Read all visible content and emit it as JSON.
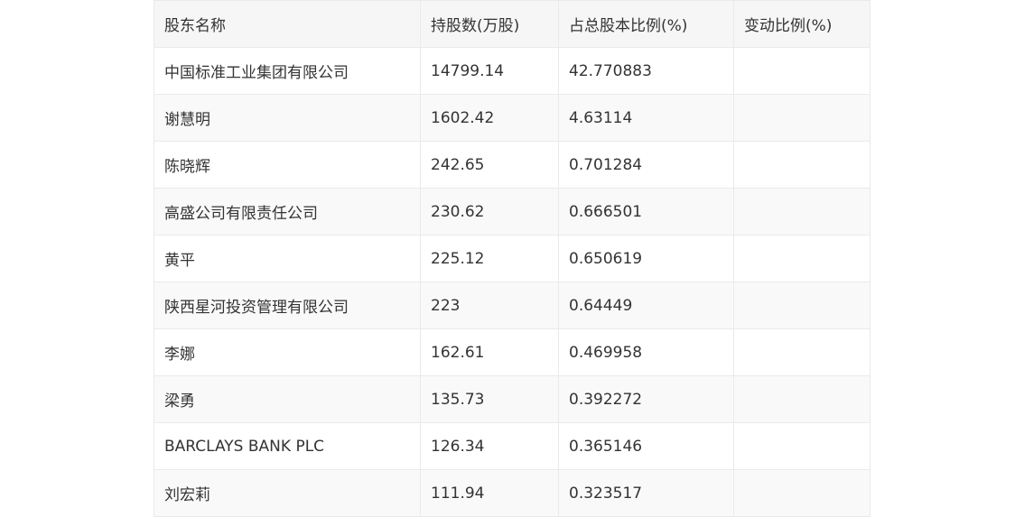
{
  "table": {
    "headers": [
      "股东名称",
      "持股数(万股)",
      "占总股本比例(%)",
      "变动比例(%)"
    ],
    "rows": [
      [
        "中国标准工业集团有限公司",
        "14799.14",
        "42.770883",
        ""
      ],
      [
        "谢慧明",
        "1602.42",
        "4.63114",
        ""
      ],
      [
        "陈晓辉",
        "242.65",
        "0.701284",
        ""
      ],
      [
        "高盛公司有限责任公司",
        "230.62",
        "0.666501",
        ""
      ],
      [
        "黄平",
        "225.12",
        "0.650619",
        ""
      ],
      [
        "陕西星河投资管理有限公司",
        "223",
        "0.64449",
        ""
      ],
      [
        "李娜",
        "162.61",
        "0.469958",
        ""
      ],
      [
        "梁勇",
        "135.73",
        "0.392272",
        ""
      ],
      [
        "BARCLAYS BANK PLC",
        "126.34",
        "0.365146",
        ""
      ],
      [
        "刘宏莉",
        "111.94",
        "0.323517",
        ""
      ]
    ]
  }
}
